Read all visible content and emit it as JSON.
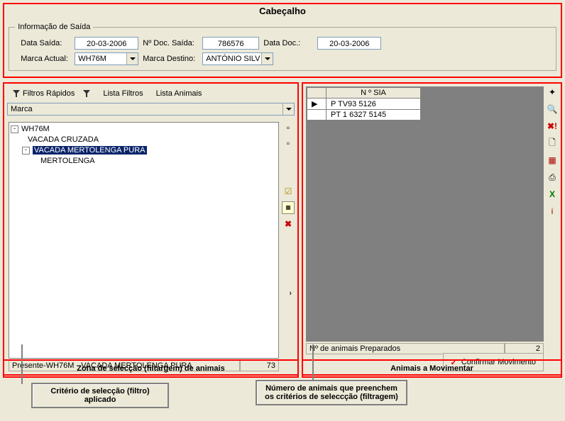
{
  "header": {
    "title": "Cabeçalho",
    "fieldset_legend": "Informação de Saída",
    "labels": {
      "data_saida": "Data Saída:",
      "n_doc_saida": "Nº Doc. Saída:",
      "data_doc": "Data Doc.:",
      "marca_actual": "Marca Actual:",
      "marca_destino": "Marca Destino:"
    },
    "values": {
      "data_saida": "20-03-2006",
      "n_doc_saida": "786576",
      "data_doc": "20-03-2006",
      "marca_actual": "WH76M",
      "marca_destino": "ANTÓNIO SILV"
    }
  },
  "left_panel": {
    "tabs": {
      "filtros_rapidos": "Filtros Rápidos",
      "lista_filtros": "Lista Filtros",
      "lista_animais": "Lista Animais"
    },
    "combo_value": "Marca",
    "tree": {
      "root": "WH76M",
      "child1": "VACADA CRUZADA",
      "child2": "VACADA MERTOLENGA PURA",
      "grandchild": "MERTOLENGA"
    },
    "status_text": "Presente-WH76M - VACADA MERTOLENGA PURA",
    "status_count": "73"
  },
  "right_panel": {
    "grid_header": "N º SIA",
    "rows": [
      "P  TV93  5126",
      "PT  1  6327  5145"
    ],
    "status_label": "Nº de animais Preparados",
    "status_count": "2",
    "confirm_label": "Confirmar Movimento"
  },
  "callouts": {
    "zona_seleccao": "Zona de selecção (filtargem) de animais",
    "animais_mov": "Animais a Movimentar",
    "criterio": "Critério de selecção (filtro) aplicado",
    "numero": "Número de animais que preenchem os critérios de seleccção (filtragem)"
  }
}
